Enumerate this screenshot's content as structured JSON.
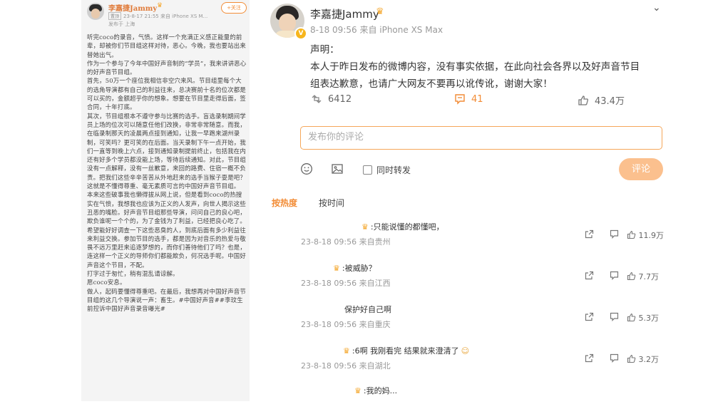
{
  "left_screenshot": {
    "author": "李嘉捷Jammy",
    "follow_label": "+关注",
    "tag": "置顶",
    "meta": "23-8-17 21:55  来自 iPhone XS M...",
    "location": "发布于 上海",
    "paragraphs": [
      "听完coco的录音，气愤。这样一个充满正义感正能量的前辈，却被你们节目组这样对待，恶心。今晚，我也要站出来替她出气。",
      "作为一个参与了今年中国好声音制的“学员”，我来讲讲恶心的好声音节目组。",
      "首先，50万一个座位我相信非空穴来风。节目组里每个大的选角导演都有自己的利益往来，总决赛前十名的位次都是可以买的，金额超乎你的想象。想要在节目里走得后面，签合同，十年打底。",
      "其次，节目组根本不遵守参与比赛的选手。盲选录制期间学员上场的位次可以随意任他们改换，非常非常随意。而我，在临录制那天的凌晨两点接到通知，让我一早跑来湖州录制，可笑吗？更可笑的在后面。当天录制下午一点开始，我们一直等到晚上六点，接到通知录制提前终止，包括我在内还有好多个学员都没能上场，等待后续通知。对此，节目组没有一点解释，没有一丝歉意，来回的路费、住宿一概不负责。把我们这些辛辛苦苦从外地赶来的选手当猴子耍是吧？这就是不懂得尊重、毫无素质可言的中国好声音节目组。",
      "本来这些破事我也懒得拔从网上说，但是看到coco的热搜实在气愤，我想我也应该为正义的人发声，向世人揭示这些丑恶的嘴脸。好声音节目组那些导演，问问自己的良心吧，欺负谁呢一个个的，为了金钱为了利益，已经把良心吃了。希望能好好调查一下这些恶臭的人，到底后面有多少利益往来利益交换。参加节目的选手，都是因为对音乐的热爱与敬畏不远万里赶来追逐梦想的，而你们善待他们了吗？也是，连这样一个正义的导师你们都能欺负，何况选手呢。中国好声音这个节目，不配。",
      "打字过于匆忙，稍有混乱请谅解。",
      "愿coco安息。",
      "做人，起码要懂得尊重吧。在最后，我想再对中国好声音节目组的这几个导演说一声：畜生。#中国好声音##李玟生前控诉中国好声音录音曝光#"
    ]
  },
  "post": {
    "username": "李嘉捷Jammy",
    "meta": "8-18 09:56 来自 iPhone XS Max",
    "content_lines": [
      "声明：",
      "本人于昨日发布的微博内容，没有事实依据，在此向社会各界以及好声音节目组表达歉意，也请广大网友不要再以讹传讹，谢谢大家！"
    ],
    "repost_count": "6412",
    "comment_count": "41",
    "like_count": "43.4万"
  },
  "composer": {
    "placeholder": "发布你的评论",
    "repost_checkbox_label": "同时转发",
    "submit_label": "评论"
  },
  "tabs": [
    "按热度",
    "按时间"
  ],
  "comments": [
    {
      "text": ":只能说懂的都懂吧，",
      "meta": "23-8-18 09:56 来自贵州",
      "likes": "11.9万"
    },
    {
      "text": ":被威胁？",
      "meta": "23-8-18 09:56 来自江西",
      "likes": "7.7万"
    },
    {
      "text": "保护好自己啊",
      "meta": "23-8-18 09:56 来自重庆",
      "likes": "5.3万"
    },
    {
      "text": ":6啊 我刚看完 结果就来澄清了",
      "meta": "23-8-18 09:56 来自湖北",
      "likes": "3.2万"
    },
    {
      "text": ":我的妈...",
      "meta": "",
      "likes": ""
    }
  ],
  "colors": {
    "accent": "#f28c36",
    "crown": "#f4a62a",
    "vip_badge": "#f7b51c"
  }
}
